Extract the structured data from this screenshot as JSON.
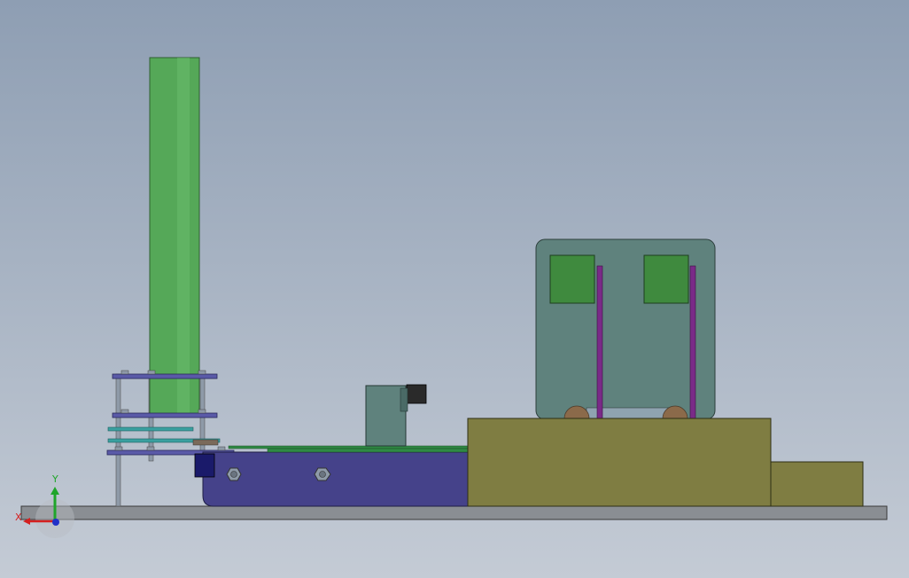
{
  "view": {
    "background_top": "#8e9eb3",
    "background_bottom": "#c4cbd5"
  },
  "triad": {
    "x_label": "X",
    "y_label": "Y",
    "x_color": "#d42020",
    "y_color": "#1fa52a",
    "z_color": "#2030c8"
  },
  "colors": {
    "base_plate": "#8a8e93",
    "tube": "#55a858",
    "conveyor_body": "#45428a",
    "olive_block": "#7f7d42",
    "hopper_frame": "#5f827d",
    "green_window": "#3f8a3e",
    "purple_rod": "#7a2a88",
    "roller": "#8b6a4a",
    "plate_blue": "#5a5aa8",
    "plate_cyan": "#3aa0a0",
    "motor": "#1a1a6a",
    "bracket": "#5f827d",
    "sensor": "#2a2a2a",
    "rail_green": "#2f8a45",
    "bolt": "#8e9aa8"
  }
}
